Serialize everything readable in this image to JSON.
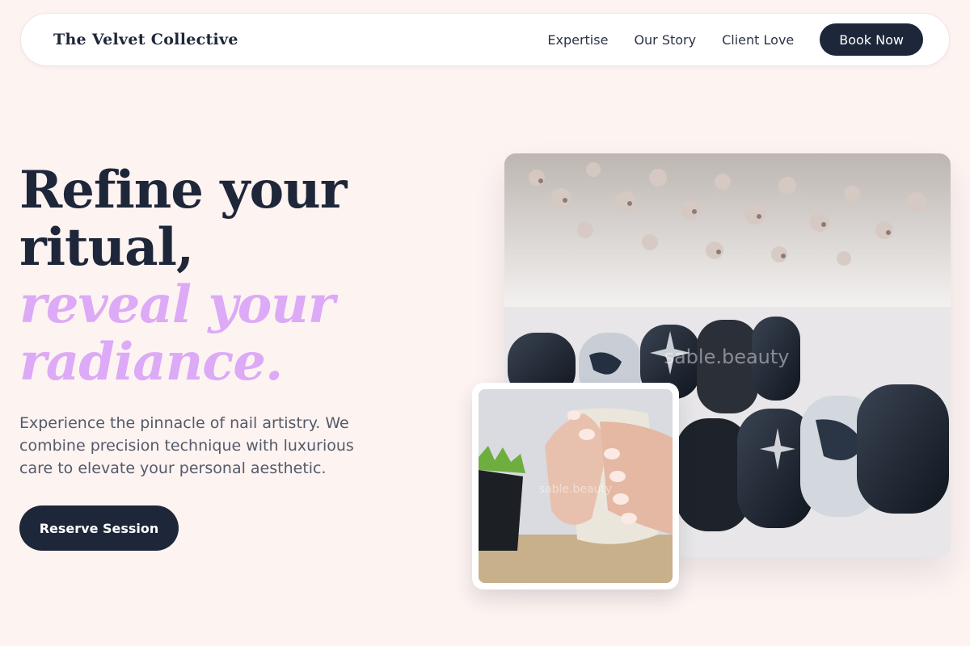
{
  "nav": {
    "brand": "The Velvet Collective",
    "links": [
      "Expertise",
      "Our Story",
      "Client Love"
    ],
    "cta": "Book Now"
  },
  "hero": {
    "title_line1": "Refine your",
    "title_line2": "ritual,",
    "accent_line1": "reveal your",
    "accent_line2": "radiance.",
    "subtitle": "Experience the pinnacle of nail artistry. We combine precision technique with luxurious care to elevate your personal aesthetic.",
    "cta": "Reserve Session"
  },
  "images": {
    "main_watermark": "sable.beauty",
    "thumb_watermark": "sable.beauty"
  },
  "colors": {
    "background": "#fdf3f1",
    "navy": "#1e2739",
    "accent_lavender": "#dcaaf7"
  }
}
